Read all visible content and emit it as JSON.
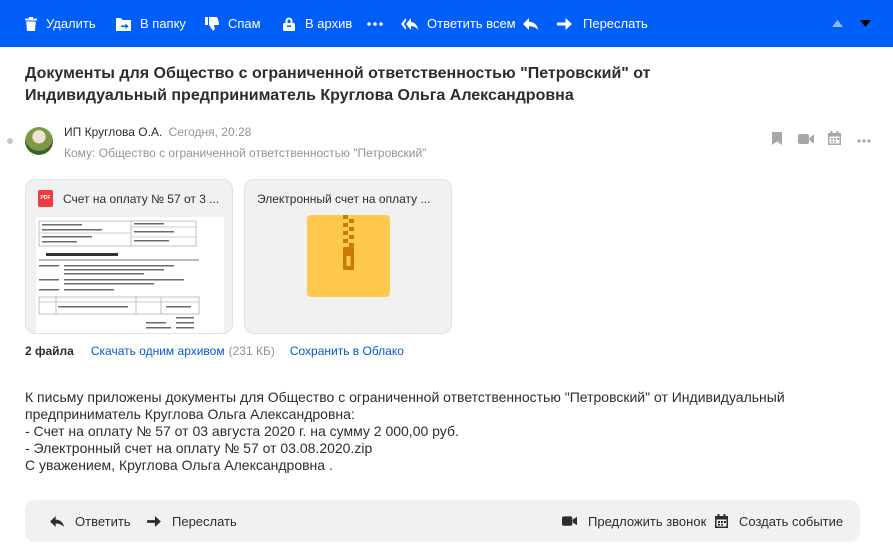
{
  "toolbar": {
    "delete_label": "Удалить",
    "move_label": "В папку",
    "spam_label": "Спам",
    "archive_label": "В архив",
    "more_label": "•••",
    "reply_all_label": "Ответить всем",
    "forward_label": "Переслать"
  },
  "message": {
    "subject": "Документы для Общество с ограниченной ответственностью \"Петровский\" от Индивидуальный предприниматель Круглова Ольга Александровна",
    "sender_name": "ИП Круглова О.А.",
    "time": "Сегодня, 20:28",
    "recipient_prefix": "Кому:",
    "recipient_name": "Общество с ограниченной ответственностью \"Петровский\""
  },
  "attachments": {
    "items": [
      {
        "title": "Счет на оплату № 57 от 3 ...",
        "type": "pdf",
        "badge": "PDF"
      },
      {
        "title": "Электронный счет на оплату ...",
        "type": "zip"
      }
    ],
    "count_label": "2 файла",
    "download_label": "Скачать одним архивом",
    "size_label": "(231 КБ)",
    "save_cloud_label": "Сохранить в Облако"
  },
  "body_lines": [
    "К письму приложены документы для Общество с ограниченной ответственностью \"Петровский\" от Индивидуальный",
    "предприниматель Круглова Ольга Александровна:",
    "- Счет на оплату № 57 от 03 августа 2020 г. на сумму 2 000,00 руб.",
    "- Электронный счет на оплату № 57 от 03.08.2020.zip",
    "С уважением, Круглова Ольга Александровна ."
  ],
  "bottom_bar": {
    "reply_label": "Ответить",
    "forward_label": "Переслать",
    "call_label": "Предложить звонок",
    "event_label": "Создать событие"
  },
  "colors": {
    "toolbar_bg": "#005ff9",
    "link": "#005bd1",
    "zip": "#ffc94d",
    "pdf": "#ee3b3b"
  }
}
